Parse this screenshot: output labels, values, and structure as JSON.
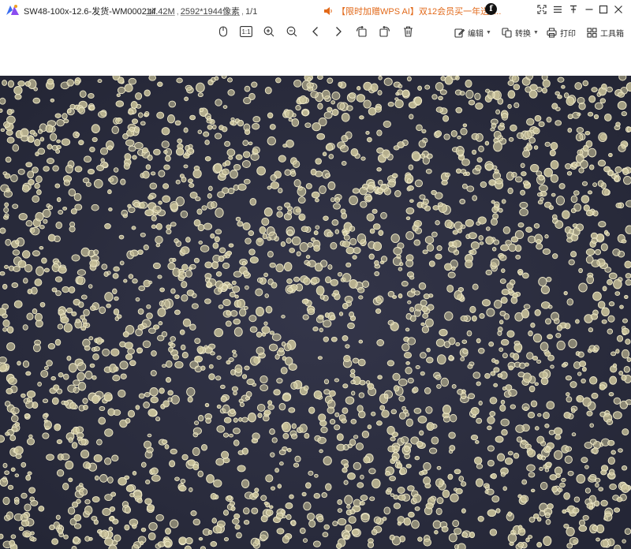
{
  "titlebar": {
    "file_name": "SW48-100x-12.6-发货-WM0002.tif",
    "file_size": "14.42M",
    "dimensions": "2592*1944像素",
    "page_indicator": "1/1",
    "promo_text": "【限时加赠WPS AI】双12会员买一年送4...",
    "avatar_letter": "f"
  },
  "toolbar": {
    "edit_label": "编辑",
    "convert_label": "转换",
    "print_label": "打印",
    "toolbox_label": "工具箱",
    "fit_label": "1:1"
  },
  "icons": {
    "app": "wps-photo-logo-icon",
    "promo": "speaker-icon",
    "window_controls": [
      "fullscreen-icon",
      "menu-icon",
      "pin-icon",
      "minimize-icon",
      "maximize-icon",
      "close-icon"
    ],
    "toolbar": [
      "mouse-icon",
      "actual-size-icon",
      "zoom-in-icon",
      "zoom-out-icon",
      "previous-icon",
      "next-icon",
      "rotate-left-icon",
      "rotate-right-icon",
      "delete-icon",
      "edit-icon",
      "convert-icon",
      "print-icon",
      "toolbox-icon"
    ]
  },
  "colors": {
    "promo": "#e26a1b",
    "image_background": "#2a2d3c",
    "cell_fill": "#c9c29a",
    "cell_edge": "#efe9c8"
  }
}
